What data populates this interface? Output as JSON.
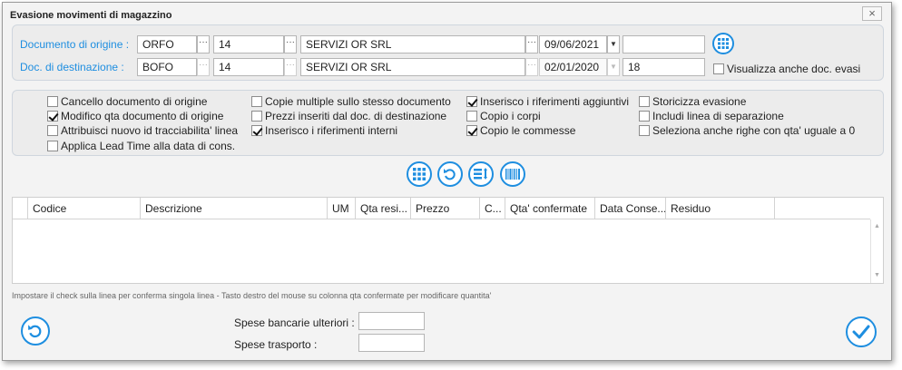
{
  "window": {
    "title": "Evasione movimenti di magazzino",
    "close": "×"
  },
  "origin": {
    "label": "Documento di origine :",
    "type": "ORFO",
    "number": "14",
    "customer": "SERVIZI OR SRL",
    "date": "09/06/2021",
    "extra": ""
  },
  "destination": {
    "label": "Doc. di destinazione :",
    "type": "BOFO",
    "number": "14",
    "customer": "SERVIZI OR SRL",
    "date": "02/01/2020",
    "extra": "18"
  },
  "ellipsis": "···",
  "show_evasi": {
    "label": "Visualizza anche doc. evasi",
    "checked": false
  },
  "options": [
    {
      "label": "Cancello documento di origine",
      "checked": false
    },
    {
      "label": "Modifico qta documento di origine",
      "checked": true
    },
    {
      "label": "Attribuisci nuovo id tracciabilita' linea",
      "checked": false
    },
    {
      "label": "Applica Lead Time alla data di cons.",
      "checked": false
    },
    {
      "label": "Copie multiple sullo stesso documento",
      "checked": false
    },
    {
      "label": "Prezzi inseriti dal doc. di destinazione",
      "checked": false
    },
    {
      "label": "Inserisco i riferimenti interni",
      "checked": true
    },
    {
      "label": "Inserisco i riferimenti aggiuntivi",
      "checked": true
    },
    {
      "label": "Copio i corpi",
      "checked": false
    },
    {
      "label": "Copio le commesse",
      "checked": true
    },
    {
      "label": "Storicizza evasione",
      "checked": false
    },
    {
      "label": "Includi linea di separazione",
      "checked": false
    },
    {
      "label": "Seleziona anche righe con qta' uguale a 0",
      "checked": false
    }
  ],
  "grid": {
    "columns": [
      "",
      "Codice",
      "Descrizione",
      "UM",
      "Qta resi...",
      "Prezzo",
      "C...",
      "Qta' confermate",
      "Data Conse...",
      "Residuo",
      ""
    ]
  },
  "hint": "Impostare il check sulla linea per conferma singola linea - Tasto destro del mouse su colonna qta confermate per modificare quantita'",
  "bottom": {
    "spese_bancarie_label": "Spese bancarie ulteriori :",
    "spese_bancarie_value": "",
    "spese_trasporto_label": "Spese trasporto :",
    "spese_trasporto_value": ""
  },
  "colors": {
    "accent": "#1e8ee0"
  }
}
